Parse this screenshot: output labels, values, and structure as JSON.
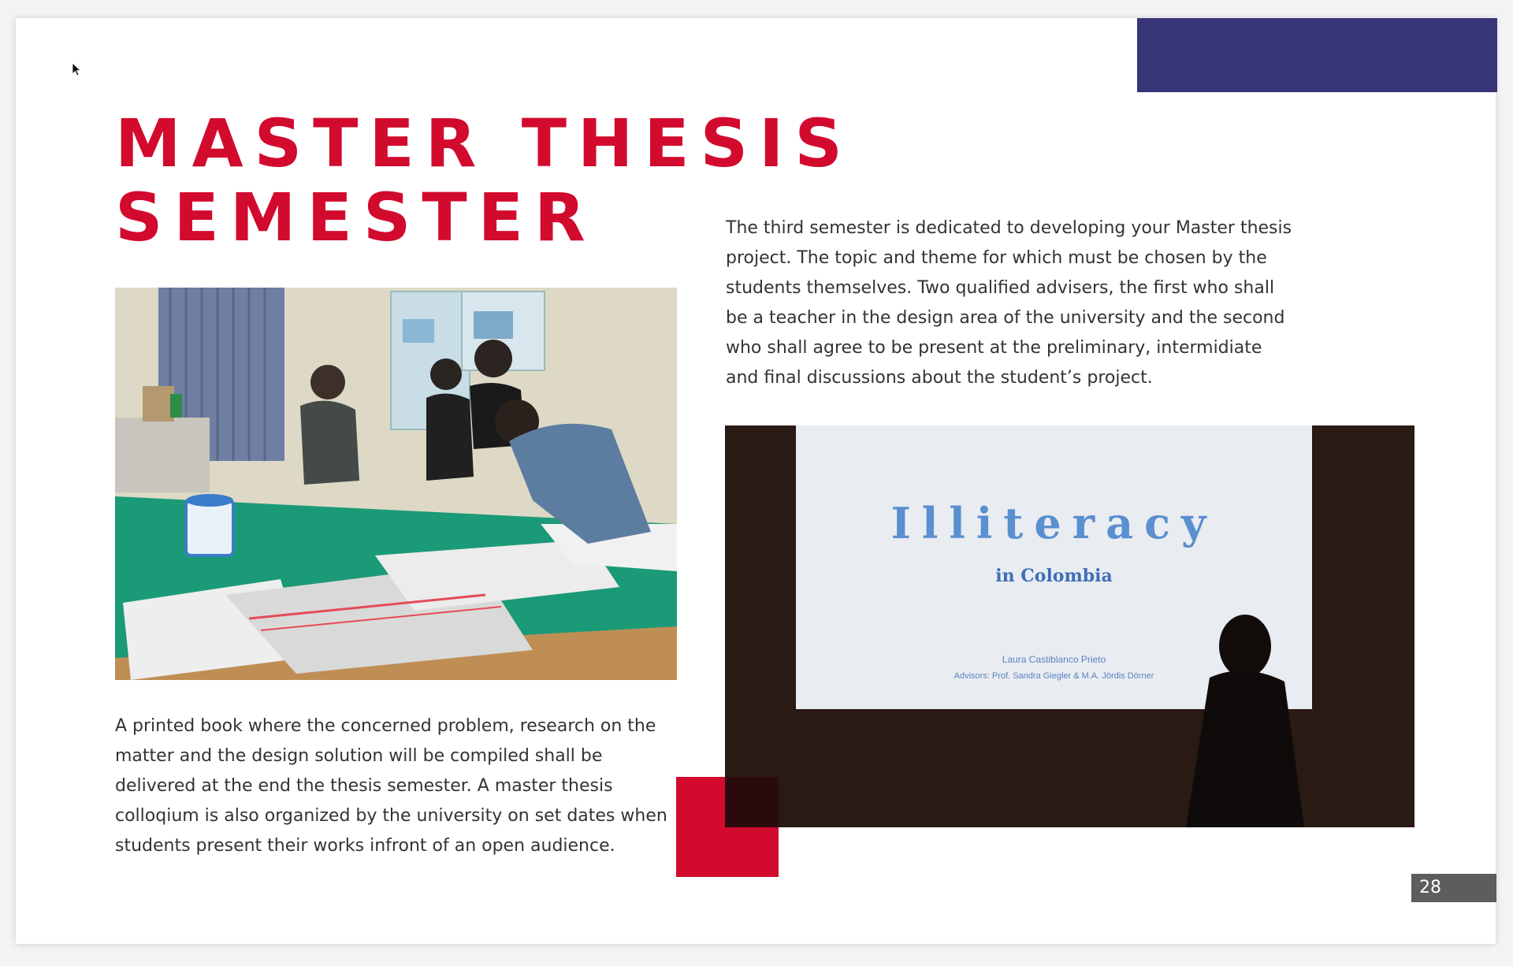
{
  "title": {
    "line1": "MASTER THESIS",
    "line2": "SEMESTER"
  },
  "paragraph_top": "The third semester is dedicated to developing your Master thesis project. The topic and theme for which must be chosen by the students themselves. Two qualified advisers, the first who shall be a teacher in the design area of the university and the second who shall agree to be present at the preliminary, intermidiate and final discussions about the student’s project.",
  "paragraph_bottom": "A printed book where the concerned problem, research on the matter and the design solution will be compiled shall be delivered at the end the thesis semester. A master thesis colloqium is also organized by the university on set dates when students present their works infront of an open audience.",
  "presentation": {
    "title": "Illiteracy",
    "subtitle": "in Colombia",
    "author": "Laura Castiblanco Prieto",
    "advisors": "Advisors: Prof. Sandra Giegler & M.A. Jördis Dörner"
  },
  "page_number": "28",
  "colors": {
    "accent_red": "#d20a2e",
    "accent_blue": "#383478",
    "page_number_bg": "#5d5d5d"
  }
}
